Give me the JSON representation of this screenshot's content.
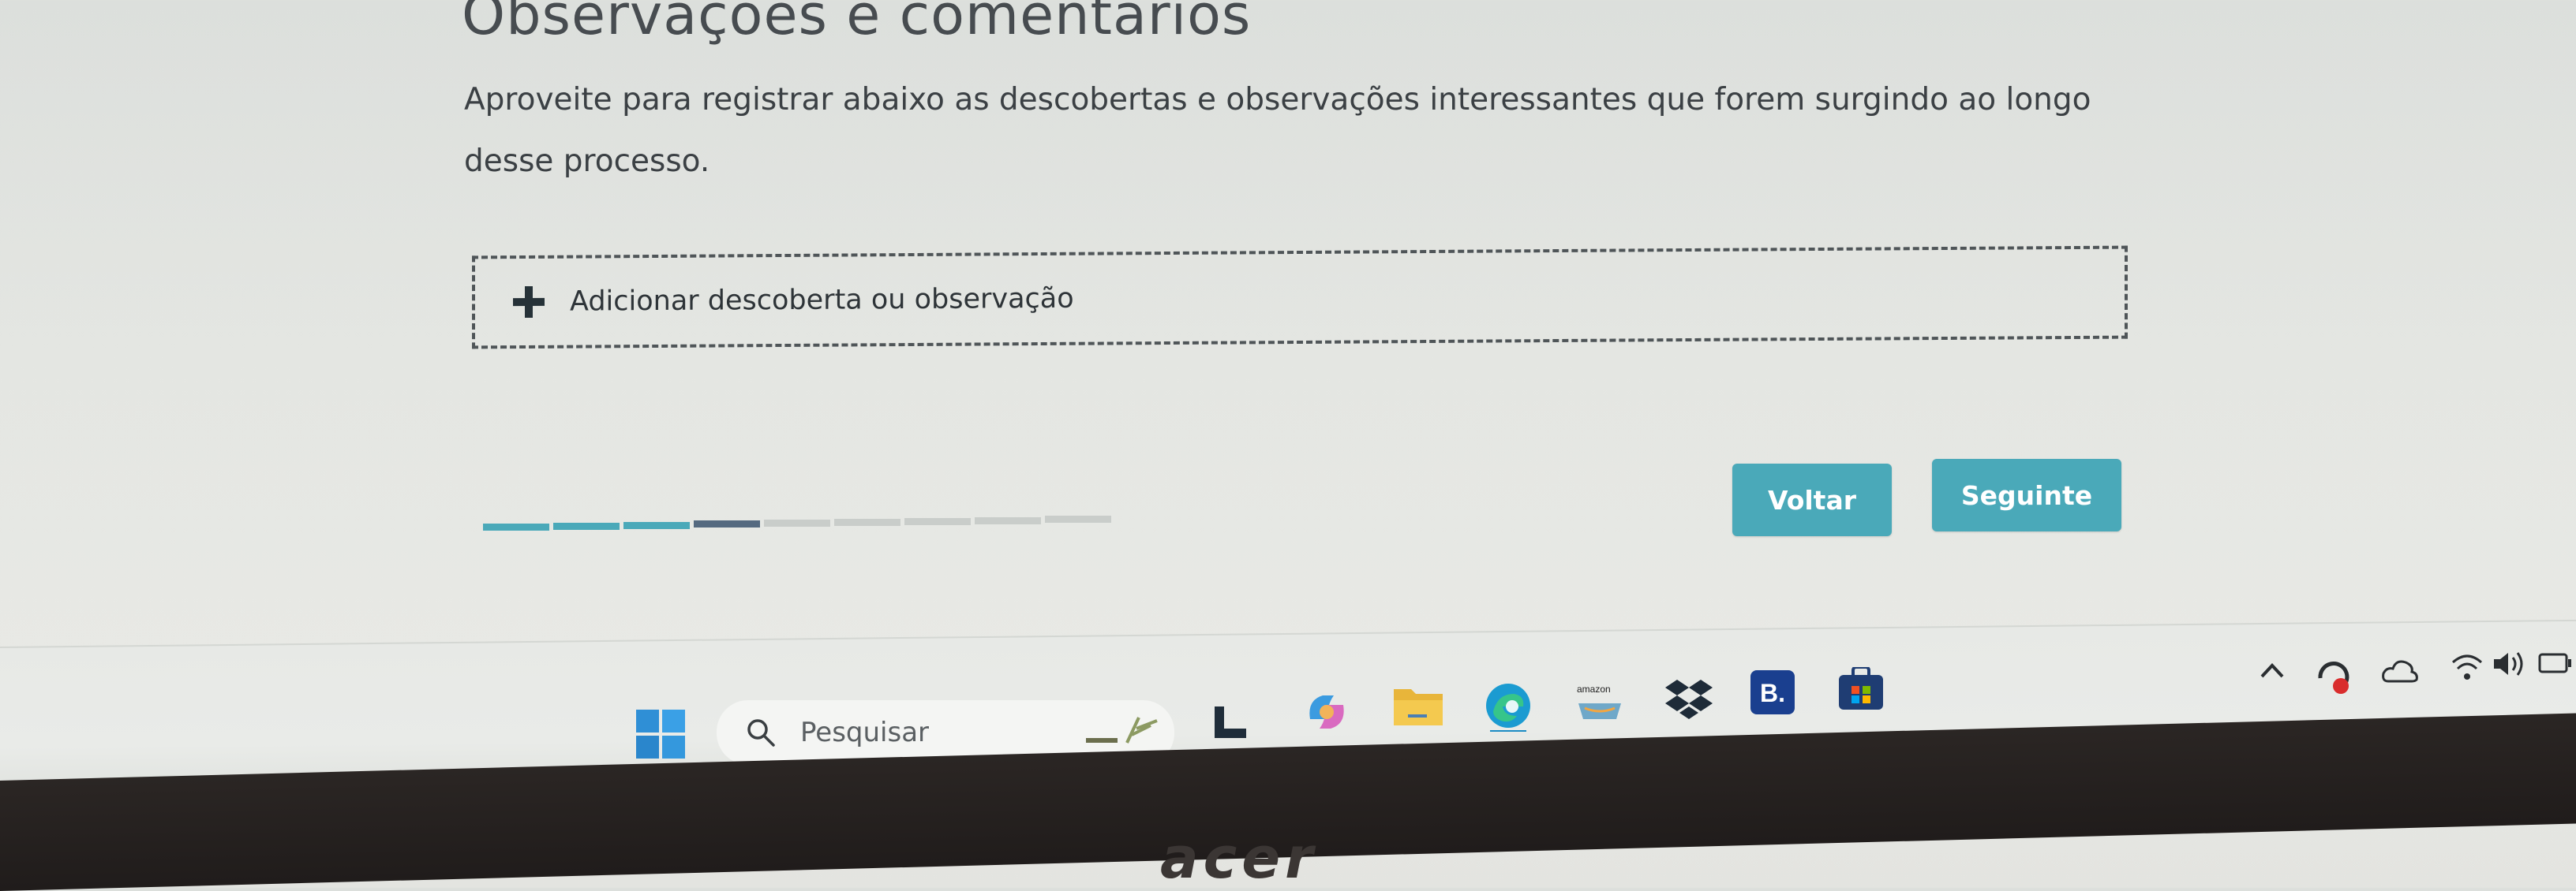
{
  "page": {
    "title": "Observações e comentários",
    "description": "Aproveite para registrar abaixo as descobertas e observações interessantes que forem surgindo ao longo desse processo."
  },
  "add_item": {
    "label": "Adicionar descoberta ou observação",
    "icon": "plus-icon"
  },
  "progress": {
    "completed_steps": 4,
    "total_steps": 9,
    "colors": {
      "done": "#4aa9b9",
      "current": "#556a80",
      "pending": "#c9cdca"
    }
  },
  "buttons": {
    "back_label": "Voltar",
    "next_label": "Seguinte",
    "color": "#4aa9b9"
  },
  "taskbar": {
    "search_placeholder": "Pesquisar",
    "pinned_icons": [
      "windows-start-icon",
      "search-icon",
      "widgets-icon",
      "app-l-icon",
      "copilot-icon",
      "file-explorer-icon",
      "edge-icon",
      "amazon-icon",
      "dropbox-icon",
      "booking-icon",
      "store-icon"
    ],
    "amazon_label": "amazon",
    "booking_label": "B.",
    "tray_icons": [
      "chevron-up-icon",
      "sync-icon",
      "cloud-icon",
      "wifi-icon",
      "volume-icon",
      "battery-icon"
    ]
  },
  "hardware": {
    "brand": "acer"
  }
}
